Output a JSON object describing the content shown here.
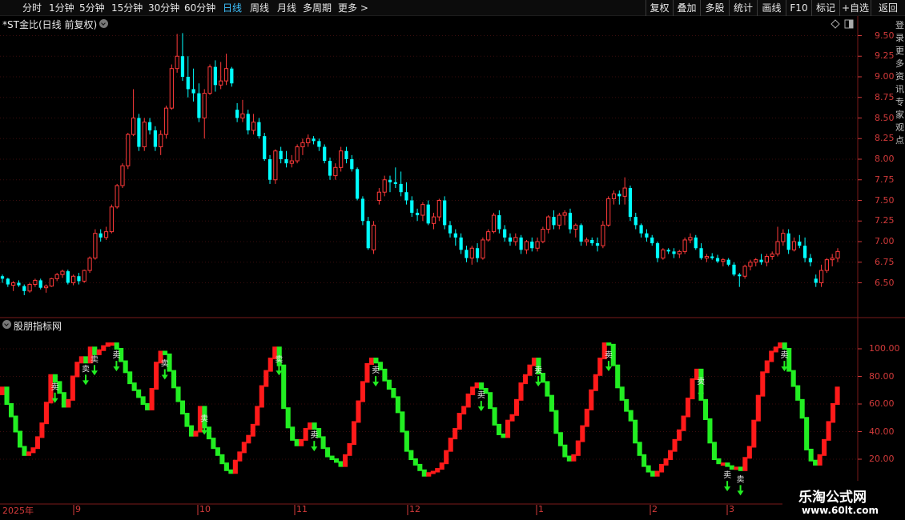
{
  "toolbar": {
    "periods": [
      "分时",
      "1分钟",
      "5分钟",
      "15分钟",
      "30分钟",
      "60分钟",
      "日线",
      "周线",
      "月线",
      "多周期",
      "更多 >"
    ],
    "active_period": "日线",
    "right_buttons": [
      "复权",
      "叠加",
      "多股",
      "统计",
      "画线",
      "F10",
      "标记",
      "+自选",
      "返回"
    ]
  },
  "main_chart": {
    "title": "*ST金比(日线 前复权)",
    "y_ticks": [
      "9.50",
      "9.25",
      "9.00",
      "8.75",
      "8.50",
      "8.25",
      "8.00",
      "7.75",
      "7.50",
      "7.25",
      "7.00",
      "6.75",
      "6.50"
    ]
  },
  "indicator": {
    "title": "股朋指标网",
    "y_ticks": [
      "100.00",
      "80.00",
      "60.00",
      "40.00",
      "20.00"
    ],
    "marker_text": "卖"
  },
  "x_axis": {
    "labels": [
      "2025年",
      "9",
      "10",
      "11",
      "12",
      "1",
      "2",
      "3"
    ]
  },
  "watermark": {
    "line1": "乐淘公式网",
    "line2": "www.60lt.com"
  },
  "right_strip_text": "登录更多资讯专家观点",
  "colors": {
    "up": "#ff3a3a",
    "down": "#00ffff",
    "ind_up": "#ff1a1a",
    "ind_down": "#22ee22",
    "axis": "#d23a3a",
    "active": "#3ec3ff"
  },
  "chart_data": {
    "type": "candlestick",
    "price_range": [
      6.3,
      9.6
    ],
    "candles_ohlc": [
      [
        6.58,
        6.6,
        6.5,
        6.55
      ],
      [
        6.55,
        6.56,
        6.45,
        6.48
      ],
      [
        6.47,
        6.52,
        6.4,
        6.5
      ],
      [
        6.5,
        6.53,
        6.45,
        6.47
      ],
      [
        6.46,
        6.48,
        6.35,
        6.4
      ],
      [
        6.4,
        6.5,
        6.38,
        6.48
      ],
      [
        6.48,
        6.55,
        6.45,
        6.53
      ],
      [
        6.53,
        6.55,
        6.42,
        6.44
      ],
      [
        6.44,
        6.48,
        6.38,
        6.46
      ],
      [
        6.46,
        6.56,
        6.45,
        6.55
      ],
      [
        6.55,
        6.62,
        6.52,
        6.6
      ],
      [
        6.6,
        6.66,
        6.56,
        6.64
      ],
      [
        6.64,
        6.66,
        6.48,
        6.5
      ],
      [
        6.5,
        6.6,
        6.47,
        6.58
      ],
      [
        6.58,
        6.62,
        6.48,
        6.52
      ],
      [
        6.52,
        6.66,
        6.5,
        6.65
      ],
      [
        6.65,
        6.82,
        6.62,
        6.8
      ],
      [
        6.8,
        7.15,
        6.78,
        7.1
      ],
      [
        7.1,
        7.15,
        7.0,
        7.05
      ],
      [
        7.05,
        7.18,
        7.02,
        7.12
      ],
      [
        7.12,
        7.45,
        7.1,
        7.42
      ],
      [
        7.42,
        7.7,
        7.4,
        7.68
      ],
      [
        7.68,
        7.95,
        7.65,
        7.92
      ],
      [
        7.92,
        8.32,
        7.88,
        8.3
      ],
      [
        8.3,
        8.85,
        8.28,
        8.5
      ],
      [
        8.5,
        8.55,
        8.1,
        8.15
      ],
      [
        8.15,
        8.5,
        8.1,
        8.45
      ],
      [
        8.45,
        8.5,
        8.3,
        8.35
      ],
      [
        8.35,
        8.4,
        8.1,
        8.15
      ],
      [
        8.15,
        8.35,
        8.05,
        8.3
      ],
      [
        8.3,
        8.65,
        8.25,
        8.62
      ],
      [
        8.62,
        9.15,
        8.6,
        9.1
      ],
      [
        9.1,
        9.52,
        9.05,
        9.25
      ],
      [
        9.25,
        9.53,
        8.95,
        9.0
      ],
      [
        9.0,
        9.25,
        8.75,
        8.85
      ],
      [
        8.85,
        9.1,
        8.7,
        8.8
      ],
      [
        8.8,
        8.92,
        8.45,
        8.5
      ],
      [
        8.5,
        8.85,
        8.25,
        8.8
      ],
      [
        8.8,
        9.15,
        8.78,
        9.12
      ],
      [
        9.12,
        9.2,
        8.82,
        8.9
      ],
      [
        8.9,
        9.18,
        8.85,
        8.95
      ],
      [
        8.95,
        9.28,
        8.9,
        9.1
      ],
      [
        9.1,
        9.12,
        8.88,
        8.92
      ],
      [
        8.6,
        8.68,
        8.45,
        8.5
      ],
      [
        8.5,
        8.72,
        8.45,
        8.55
      ],
      [
        8.55,
        8.6,
        8.3,
        8.35
      ],
      [
        8.35,
        8.55,
        8.3,
        8.45
      ],
      [
        8.45,
        8.5,
        8.25,
        8.28
      ],
      [
        8.28,
        8.32,
        7.98,
        8.0
      ],
      [
        8.0,
        8.05,
        7.7,
        7.75
      ],
      [
        7.75,
        8.12,
        7.7,
        8.1
      ],
      [
        8.1,
        8.15,
        7.95,
        8.0
      ],
      [
        8.0,
        8.1,
        7.9,
        7.95
      ],
      [
        7.95,
        8.05,
        7.9,
        7.98
      ],
      [
        7.98,
        8.18,
        7.95,
        8.15
      ],
      [
        8.15,
        8.25,
        8.05,
        8.2
      ],
      [
        8.2,
        8.3,
        8.15,
        8.25
      ],
      [
        8.25,
        8.28,
        8.18,
        8.22
      ],
      [
        8.22,
        8.25,
        8.1,
        8.15
      ],
      [
        8.15,
        8.18,
        7.95,
        7.98
      ],
      [
        7.98,
        8.02,
        7.75,
        7.8
      ],
      [
        7.8,
        7.95,
        7.75,
        7.9
      ],
      [
        7.9,
        8.15,
        7.85,
        8.1
      ],
      [
        8.1,
        8.15,
        7.95,
        8.0
      ],
      [
        8.0,
        8.05,
        7.85,
        7.88
      ],
      [
        7.88,
        7.9,
        7.5,
        7.52
      ],
      [
        7.52,
        7.55,
        7.2,
        7.25
      ],
      [
        7.25,
        7.3,
        6.9,
        6.92
      ],
      [
        6.9,
        7.25,
        6.85,
        7.2
      ],
      [
        7.5,
        7.65,
        7.45,
        7.6
      ],
      [
        7.6,
        7.8,
        7.55,
        7.75
      ],
      [
        7.75,
        7.8,
        7.6,
        7.72
      ],
      [
        7.72,
        7.9,
        7.65,
        7.7
      ],
      [
        7.7,
        7.85,
        7.55,
        7.6
      ],
      [
        7.6,
        7.72,
        7.45,
        7.5
      ],
      [
        7.5,
        7.55,
        7.3,
        7.35
      ],
      [
        7.35,
        7.4,
        7.25,
        7.32
      ],
      [
        7.32,
        7.48,
        7.25,
        7.45
      ],
      [
        7.45,
        7.5,
        7.2,
        7.22
      ],
      [
        7.22,
        7.35,
        7.15,
        7.3
      ],
      [
        7.3,
        7.52,
        7.25,
        7.5
      ],
      [
        7.5,
        7.55,
        7.15,
        7.2
      ],
      [
        7.2,
        7.25,
        7.05,
        7.1
      ],
      [
        7.1,
        7.15,
        6.95,
        7.05
      ],
      [
        7.05,
        7.1,
        6.85,
        6.9
      ],
      [
        6.9,
        6.95,
        6.75,
        6.8
      ],
      [
        6.8,
        6.95,
        6.72,
        6.92
      ],
      [
        6.92,
        6.98,
        6.75,
        6.8
      ],
      [
        6.8,
        7.05,
        6.78,
        7.02
      ],
      [
        7.02,
        7.15,
        7.0,
        7.12
      ],
      [
        7.12,
        7.35,
        7.1,
        7.32
      ],
      [
        7.32,
        7.38,
        7.1,
        7.15
      ],
      [
        7.15,
        7.2,
        7.0,
        7.05
      ],
      [
        7.05,
        7.1,
        6.95,
        7.0
      ],
      [
        7.0,
        7.1,
        6.95,
        7.05
      ],
      [
        7.05,
        7.08,
        6.85,
        6.9
      ],
      [
        6.9,
        7.02,
        6.85,
        7.0
      ],
      [
        7.0,
        7.05,
        6.88,
        6.92
      ],
      [
        6.92,
        7.05,
        6.88,
        7.0
      ],
      [
        7.0,
        7.18,
        6.98,
        7.15
      ],
      [
        7.15,
        7.32,
        7.1,
        7.3
      ],
      [
        7.3,
        7.38,
        7.15,
        7.2
      ],
      [
        7.2,
        7.35,
        7.15,
        7.32
      ],
      [
        7.32,
        7.38,
        7.2,
        7.35
      ],
      [
        7.35,
        7.4,
        7.1,
        7.15
      ],
      [
        7.15,
        7.22,
        7.05,
        7.2
      ],
      [
        7.2,
        7.22,
        6.95,
        7.0
      ],
      [
        7.0,
        7.05,
        6.95,
        7.02
      ],
      [
        7.02,
        7.05,
        6.95,
        6.98
      ],
      [
        6.98,
        7.05,
        6.88,
        6.95
      ],
      [
        6.95,
        7.25,
        6.92,
        7.2
      ],
      [
        7.2,
        7.55,
        7.18,
        7.52
      ],
      [
        7.52,
        7.62,
        7.45,
        7.58
      ],
      [
        7.58,
        7.62,
        7.45,
        7.55
      ],
      [
        7.55,
        7.78,
        7.45,
        7.65
      ],
      [
        7.65,
        7.68,
        7.25,
        7.3
      ],
      [
        7.3,
        7.35,
        7.15,
        7.2
      ],
      [
        7.2,
        7.22,
        7.05,
        7.1
      ],
      [
        7.1,
        7.15,
        7.0,
        7.05
      ],
      [
        7.05,
        7.08,
        6.95,
        6.98
      ],
      [
        6.98,
        7.0,
        6.75,
        6.8
      ],
      [
        6.8,
        6.92,
        6.78,
        6.9
      ],
      [
        6.9,
        6.92,
        6.85,
        6.88
      ],
      [
        6.88,
        6.92,
        6.8,
        6.85
      ],
      [
        6.85,
        6.9,
        6.8,
        6.88
      ],
      [
        6.88,
        7.05,
        6.85,
        7.02
      ],
      [
        7.02,
        7.1,
        6.98,
        7.05
      ],
      [
        7.05,
        7.08,
        6.9,
        6.92
      ],
      [
        6.92,
        6.98,
        6.78,
        6.8
      ],
      [
        6.8,
        6.85,
        6.75,
        6.82
      ],
      [
        6.82,
        6.86,
        6.78,
        6.8
      ],
      [
        6.8,
        6.84,
        6.74,
        6.76
      ],
      [
        6.76,
        6.8,
        6.7,
        6.78
      ],
      [
        6.78,
        6.8,
        6.7,
        6.72
      ],
      [
        6.72,
        6.75,
        6.58,
        6.6
      ],
      [
        6.6,
        6.62,
        6.45,
        6.58
      ],
      [
        6.58,
        6.72,
        6.55,
        6.7
      ],
      [
        6.7,
        6.78,
        6.65,
        6.75
      ],
      [
        6.75,
        6.8,
        6.7,
        6.78
      ],
      [
        6.78,
        6.85,
        6.72,
        6.75
      ],
      [
        6.75,
        6.85,
        6.7,
        6.82
      ],
      [
        6.82,
        6.88,
        6.78,
        6.85
      ],
      [
        6.85,
        7.18,
        6.82,
        7.0
      ],
      [
        7.0,
        7.15,
        6.95,
        7.1
      ],
      [
        7.1,
        7.15,
        6.85,
        6.9
      ],
      [
        6.9,
        7.05,
        6.88,
        7.0
      ],
      [
        7.0,
        7.08,
        6.92,
        6.95
      ],
      [
        6.95,
        7.05,
        6.75,
        6.8
      ],
      [
        6.8,
        6.85,
        6.7,
        6.75
      ],
      [
        6.55,
        6.6,
        6.45,
        6.5
      ],
      [
        6.5,
        6.72,
        6.45,
        6.65
      ],
      [
        6.65,
        6.8,
        6.62,
        6.78
      ],
      [
        6.78,
        6.85,
        6.7,
        6.8
      ],
      [
        6.8,
        6.92,
        6.75,
        6.88
      ]
    ],
    "indicator_values": [
      72,
      60,
      51,
      40,
      29,
      23,
      25,
      28,
      36,
      46,
      61,
      81,
      76,
      68,
      58,
      63,
      80,
      90,
      94,
      90,
      101,
      96,
      99,
      102,
      104,
      104,
      100,
      91,
      83,
      75,
      70,
      65,
      60,
      56,
      71,
      90,
      98,
      96,
      84,
      72,
      62,
      53,
      44,
      37,
      40,
      58,
      43,
      35,
      28,
      23,
      17,
      12,
      10,
      19,
      25,
      32,
      37,
      45,
      58,
      73,
      84,
      93,
      101,
      88,
      57,
      43,
      34,
      30,
      34,
      42,
      46,
      42,
      36,
      28,
      22,
      20,
      18,
      15,
      23,
      31,
      47,
      62,
      76,
      89,
      93,
      90,
      85,
      77,
      71,
      65,
      54,
      40,
      26,
      20,
      16,
      12,
      8,
      10,
      11,
      13,
      17,
      26,
      35,
      42,
      53,
      58,
      67,
      72,
      75,
      71,
      68,
      57,
      45,
      38,
      36,
      48,
      52,
      63,
      75,
      81,
      88,
      93,
      82,
      76,
      66,
      55,
      39,
      30,
      22,
      19,
      23,
      33,
      44,
      56,
      70,
      81,
      93,
      104,
      103,
      88,
      72,
      63,
      55,
      48,
      32,
      23,
      15,
      11,
      8,
      11,
      16,
      20,
      26,
      34,
      41,
      51,
      64,
      78,
      85,
      63,
      49,
      32,
      20,
      17,
      17,
      15,
      13,
      14,
      12,
      21,
      29,
      48,
      66,
      83,
      91,
      98,
      101,
      104,
      100,
      84,
      73,
      63,
      50,
      27,
      19,
      16,
      23,
      34,
      47,
      60,
      72
    ]
  }
}
